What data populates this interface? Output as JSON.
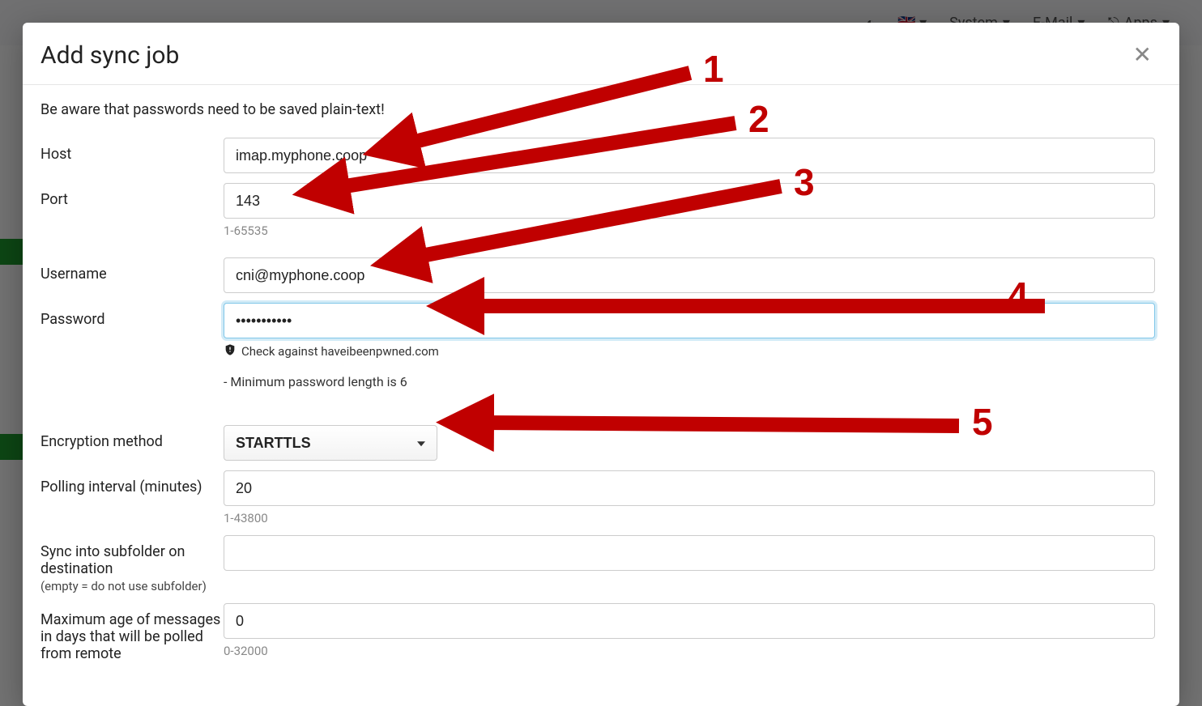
{
  "topbar": {
    "system": "System",
    "email": "E-Mail",
    "apps": "Apps"
  },
  "modal": {
    "title": "Add sync job",
    "notice": "Be aware that passwords need to be saved plain-text!",
    "close_aria": "Close"
  },
  "fields": {
    "host": {
      "label": "Host",
      "value": "imap.myphone.coop"
    },
    "port": {
      "label": "Port",
      "value": "143",
      "helper": "1-65535"
    },
    "username": {
      "label": "Username",
      "value": "cni@myphone.coop"
    },
    "password": {
      "label": "Password",
      "value": "•••••••••••",
      "check": "Check against haveibeenpwned.com",
      "note": "- Minimum password length is 6"
    },
    "encryption": {
      "label": "Encryption method",
      "value": "STARTTLS"
    },
    "polling": {
      "label": "Polling interval (minutes)",
      "value": "20",
      "helper": "1-43800"
    },
    "subfolder": {
      "label": "Sync into subfolder on destination",
      "sub": "(empty = do not use subfolder)",
      "value": ""
    },
    "maxage": {
      "label": "Maximum age of messages in days that will be polled from remote",
      "value": "0",
      "helper": "0-32000"
    }
  },
  "annotations": {
    "n1": "1",
    "n2": "2",
    "n3": "3",
    "n4": "4",
    "n5": "5"
  }
}
